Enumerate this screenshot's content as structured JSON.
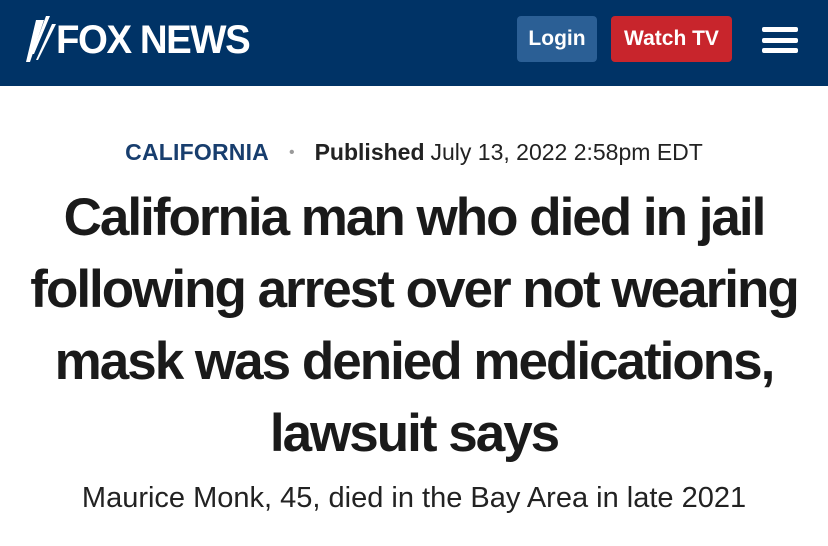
{
  "header": {
    "logo_text": "FOX NEWS",
    "login_label": "Login",
    "watch_label": "Watch TV",
    "menu_icon": "hamburger-menu-icon",
    "colors": {
      "background": "#003366",
      "login": "#2b5f95",
      "watch": "#c8252c"
    }
  },
  "article": {
    "category": "CALIFORNIA",
    "separator": "•",
    "published_label": "Published",
    "published_date": "July 13, 2022 2:58pm EDT",
    "headline": "California man who died in jail following arrest over not wearing mask was denied medications, lawsuit says",
    "subheadline": "Maurice Monk, 45, died in the Bay Area in late 2021"
  }
}
